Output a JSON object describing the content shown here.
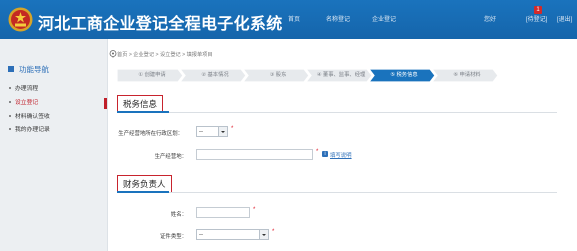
{
  "header": {
    "brand": "河北工商企业登记全程电子化系统",
    "nav": [
      "首页",
      "名称登记",
      "企业登记"
    ],
    "greeting": "您好",
    "notification_count": "1",
    "todo_link": "[待登记]",
    "logout": "[退出]"
  },
  "sidebar": {
    "title": "功能导航",
    "items": [
      {
        "label": "办理流程",
        "active": false
      },
      {
        "label": "设立登记",
        "active": true
      },
      {
        "label": "材料确认签收",
        "active": false
      },
      {
        "label": "我的办理记录",
        "active": false
      }
    ]
  },
  "breadcrumb": "首页 > 企业登记 > 设立登记 > 填报单项目",
  "steps": [
    {
      "label": "① 创建申请",
      "state": "done"
    },
    {
      "label": "② 基本情况",
      "state": "done"
    },
    {
      "label": "③ 股东",
      "state": "done"
    },
    {
      "label": "④ 董事、监事、经理",
      "state": "done"
    },
    {
      "label": "⑤ 税务信息",
      "state": "active"
    },
    {
      "label": "⑥ 申请材料",
      "state": "todo"
    }
  ],
  "tax_section": {
    "title": "税务信息",
    "region_label": "生产经营地所在行政区划：",
    "region_value": "--",
    "address_label": "生产经营地：",
    "fill_link": "填写说明"
  },
  "finance_section": {
    "title": "财务负责人",
    "name_label": "姓名：",
    "idtype_label": "证件类型：",
    "idtype_value": "--"
  },
  "colors": {
    "header_blue": "#1a73bd",
    "active_step": "#1a73bd",
    "highlight_red": "#c8242e"
  }
}
